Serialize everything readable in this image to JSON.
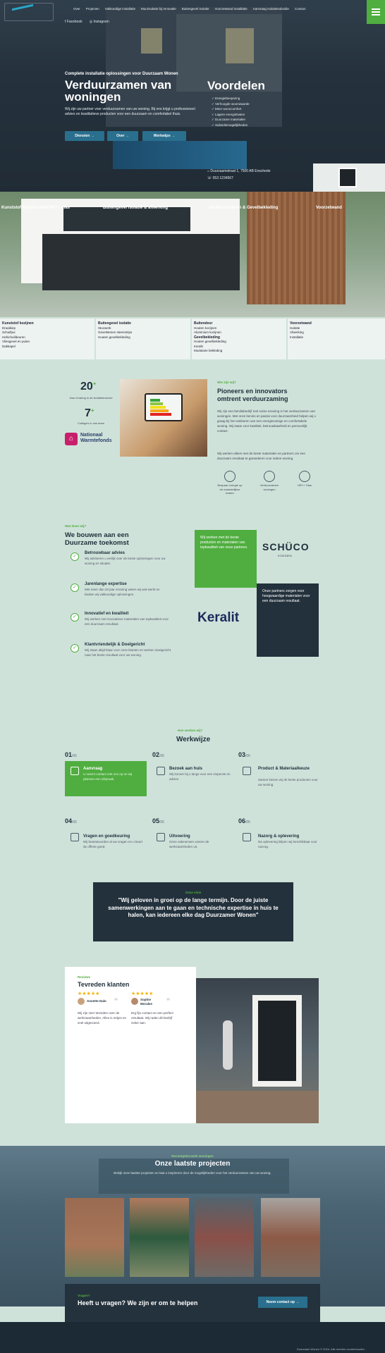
{
  "nav": {
    "items": [
      "Over",
      "Projecten",
      "Vakkundige installatie",
      "Muurisolatie bij renovatie",
      "Buitengevel isolatie",
      "Voorzetwand installatie",
      "Aanvraag Isolatiesubsidie",
      "Contact"
    ]
  },
  "social": {
    "facebook": "Facebook",
    "instagram": "Instagram"
  },
  "hero": {
    "eyebrow": "Complete installatie oplossingen voor Duurzaam Wonen",
    "title": "Verduurzamen van woningen",
    "desc": "Wij zijn uw partner voor verduurzamen van uw woning. Bij ons krijgt u professioneel advies en kwalitatieve producten voor een duurzaam en comfortabel thuis.",
    "buttons": [
      "Diensten →",
      "Over →",
      "Werkwijze →"
    ]
  },
  "voordelen": {
    "title": "Voordelen",
    "items": [
      "Energiebesparing",
      "Verhoogde woonwaarde",
      "Meer wooncomfort",
      "Lagere energielasten",
      "Duurzame materialen",
      "Subsidiemogelijkheden"
    ]
  },
  "contact": {
    "address": "Duurzaamstraat 1, 7500 AB Enschede",
    "phone": "053 1234567"
  },
  "strip": {
    "labels": [
      "Kunststof kozijnen met HR++ glas",
      "Buitengevel isolatie & afwerking",
      "Houten kozijnen & Gevelbekleding",
      "Voorzetwand"
    ]
  },
  "categories": [
    {
      "title": "Kunststof kozijnen",
      "items": [
        "Draaikiep",
        "Schuifpui",
        "Hefschuifdeuren",
        "Vliesgevel en puien",
        "Dakkapel"
      ]
    },
    {
      "title": "Buitengevel isolatie",
      "items": [
        "Stucwerk",
        "Gevelstenen steenstrips",
        "Houten gevelbekleding"
      ]
    },
    {
      "title": "Buitendeur",
      "items": [
        "Houten kozijnen",
        "Aluminium kozijnen"
      ],
      "title2": "Gevelbekleding",
      "items2": [
        "Houten gevelbekleding",
        "Keralit",
        "Modulaire bekleding"
      ]
    },
    {
      "title": "Voorzetwand",
      "items": [
        "Isolatie",
        "Afwerking",
        "Installatie"
      ]
    }
  ],
  "stats": {
    "years": "20",
    "years_label": "Jaar ervaring in de isolatiebranche",
    "team": "7",
    "team_label": "Collega's in ons team",
    "fund": "Nationaal Warmtefonds"
  },
  "about": {
    "eyebrow": "Wie zijn wij?",
    "title": "Pioneers en innovators omtrent verduurzaming",
    "desc": "Wij zijn een familiebedrijf met ruime ervaring in het verduurzamen van woningen. Met onze kennis en passie voor duurzaamheid helpen wij u graag bij het realiseren van een energiezuinige en comfortabele woning. Wij staan voor kwaliteit, betrouwbaarheid en persoonlijk contact.",
    "desc2": "Wij werken alleen met de beste materialen en partners om een duurzaam resultaat te garanderen voor iedere woning.",
    "icons": [
      "Bespaar energie op de maandelijkse kosten",
      "Verduurzamen woningen",
      "HR++ Glas"
    ]
  },
  "build": {
    "eyebrow": "Wat doen wij?",
    "title": "We bouwen aan een Duurzame toekomst",
    "items": [
      {
        "title": "Betrouwbaar advies",
        "desc": "Wij adviseren u eerlijk over de beste oplossingen voor uw woning en situatie."
      },
      {
        "title": "Jarenlange expertise",
        "desc": "Met meer dan 20 jaar ervaring weten wij wat werkt en bieden wij vakkundige oplossingen."
      },
      {
        "title": "Innovatief en kwaliteit",
        "desc": "Wij werken met innovatieve materialen van topkwaliteit voor een duurzaam resultaat."
      },
      {
        "title": "Klantvriendelijk & Doelgericht",
        "desc": "Wij staan altijd klaar voor onze klanten en werken doelgericht naar het beste resultaat voor uw woning."
      }
    ],
    "green_box": "Wij werken met de beste producten en materialen van topkwaliteit van onze partners.",
    "dark_box": "Onze partners zorgen voor hoogwaardige materialen voor een duurzaam resultaat.",
    "logo1": "SCHÜCO",
    "logo1_sub": "KOZIJNEN",
    "logo2": "Keralit"
  },
  "work": {
    "eyebrow": "Hoe werken wij?",
    "title": "Werkwijze",
    "steps": [
      {
        "num": "01",
        "title": "Aanvraag",
        "desc": "U neemt contact met ons op en wij plannen een afspraak."
      },
      {
        "num": "02",
        "title": "Bezoek aan huis",
        "desc": "Wij komen bij u langs voor een inspectie en advies."
      },
      {
        "num": "03",
        "title": "Product & Materiaalkeuze",
        "desc": "Samen kiezen wij de beste producten voor uw woning."
      },
      {
        "num": "04",
        "title": "Vragen en goedkeuring",
        "desc": "Wij beantwoorden al uw vragen en u keurt de offerte goed."
      },
      {
        "num": "05",
        "title": "Uitvoering",
        "desc": "Onze vakmensen voeren de werkzaamheden uit."
      },
      {
        "num": "06",
        "title": "Nazorg & oplevering",
        "desc": "Na oplevering blijven wij beschikbaar voor nazorg."
      }
    ],
    "of": "/06"
  },
  "quote": {
    "eyebrow": "Onze visie",
    "text": "\"Wij geloven in groei op de lange termijn. Door de juiste samenwerkingen aan te gaan en technische expertise in huis te halen, kan iedereen elke dag Duurzamer Wonen\""
  },
  "reviews": {
    "eyebrow": "Reviews",
    "title": "Tevreden klanten",
    "items": [
      {
        "name": "Annette Dalo",
        "text": "Wij zijn zeer tevreden over de werkzaamheden. Alles is netjes en snel uitgevoerd."
      },
      {
        "name": "Sophie Morales",
        "text": "Erg fijn contact en een perfect resultaat. Wij raden dit bedrijf zeker aan."
      }
    ]
  },
  "projects": {
    "eyebrow": "Recentgebouwde woningen",
    "title": "Onze laatste projecten",
    "desc": "Bekijk onze laatste projecten en laat u inspireren door de mogelijkheden voor het verduurzamen van uw woning."
  },
  "cta": {
    "eyebrow": "Vragen?",
    "title": "Heeft u vragen? We zijn er om te helpen",
    "button": "Neem contact op →"
  },
  "footer": {
    "text": "Duurzaam Wonen © 2024. Alle rechten voorbehouden."
  },
  "colors": {
    "green": "#4fae3f",
    "dark": "#23313c",
    "blue": "#2a6f8e",
    "bg": "#cfe2da"
  }
}
